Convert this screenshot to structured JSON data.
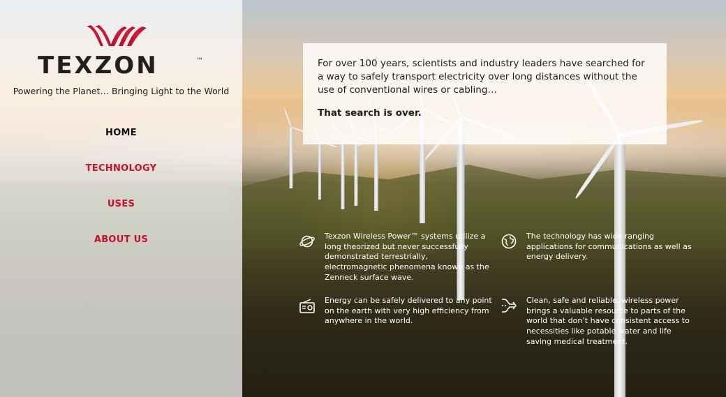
{
  "brand": {
    "name": "TEXZON",
    "trademark": "™",
    "tagline": "Powering the Planet… Bringing Light to the World",
    "accent_color": "#c8102e"
  },
  "nav": {
    "items": [
      {
        "label": "HOME",
        "active": true
      },
      {
        "label": "TECHNOLOGY"
      },
      {
        "label": "USES"
      },
      {
        "label": "ABOUT US"
      }
    ]
  },
  "intro": {
    "paragraph": "For over 100 years, scientists and industry leaders have searched for a way to safely transport electricity over long distances without the use of conventional wires or cabling…",
    "emphasis": "That search is over."
  },
  "features": [
    {
      "icon": "planet-icon",
      "text": "Texzon Wireless Power™ systems utilize a long theorized but never successfully demonstrated terrestrially, electromagnetic phenomena known as the Zenneck surface wave."
    },
    {
      "icon": "globe-icon",
      "text": "The technology has wide ranging applications for communications as well as energy delivery."
    },
    {
      "icon": "radio-icon",
      "text": "Energy can be safely delivered to any point on the earth with very high efficiency from anywhere in the world."
    },
    {
      "icon": "branch-arrows-icon",
      "text": "Clean, safe and reliable, wireless power brings a valuable resource to parts of the world that don’t have consistent access to necessities like potable water and life saving medical treatment."
    }
  ]
}
